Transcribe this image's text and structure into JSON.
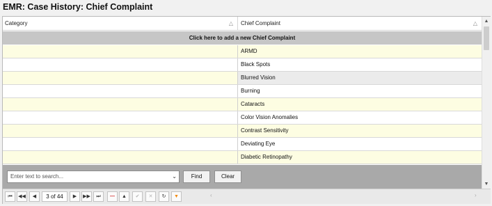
{
  "title": "EMR: Case History: Chief Complaint",
  "columns": {
    "category": "Category",
    "chief_complaint": "Chief Complaint",
    "sort_icon": "△"
  },
  "add_row_label": "Click here to add a new Chief Complaint",
  "rows": [
    {
      "category": "",
      "chief_complaint": "ARMD"
    },
    {
      "category": "",
      "chief_complaint": "Black Spots"
    },
    {
      "category": "",
      "chief_complaint": "Blurred Vision"
    },
    {
      "category": "",
      "chief_complaint": "Burning"
    },
    {
      "category": "",
      "chief_complaint": "Cataracts"
    },
    {
      "category": "",
      "chief_complaint": "Color Vision Anomalies"
    },
    {
      "category": "",
      "chief_complaint": "Contrast Sensitivity"
    },
    {
      "category": "",
      "chief_complaint": "Deviating Eye"
    },
    {
      "category": "",
      "chief_complaint": "Diabetic Retinopathy"
    }
  ],
  "search": {
    "placeholder": "Enter text to search...",
    "find_label": "Find",
    "clear_label": "Clear"
  },
  "navigator": {
    "page_text": "3 of 44",
    "icons": {
      "first": "⏮",
      "prev_page": "◀◀",
      "prev": "◀",
      "next": "▶",
      "next_page": "▶▶",
      "last": "⏭",
      "delete": "—",
      "up": "▲",
      "confirm": "✔",
      "cancel": "✕",
      "refresh": "↻",
      "filter": "▼"
    }
  },
  "scroll_icons": {
    "up": "▲",
    "down": "▼",
    "left": "‹",
    "right": "›",
    "dropdown": "⌄"
  },
  "colors": {
    "odd_row": "#fdfde2",
    "add_row_bg": "#c6c6c6",
    "search_bar_bg": "#a9a9a9",
    "delete_red": "#d01b1b",
    "filter_orange": "#f28a10"
  }
}
